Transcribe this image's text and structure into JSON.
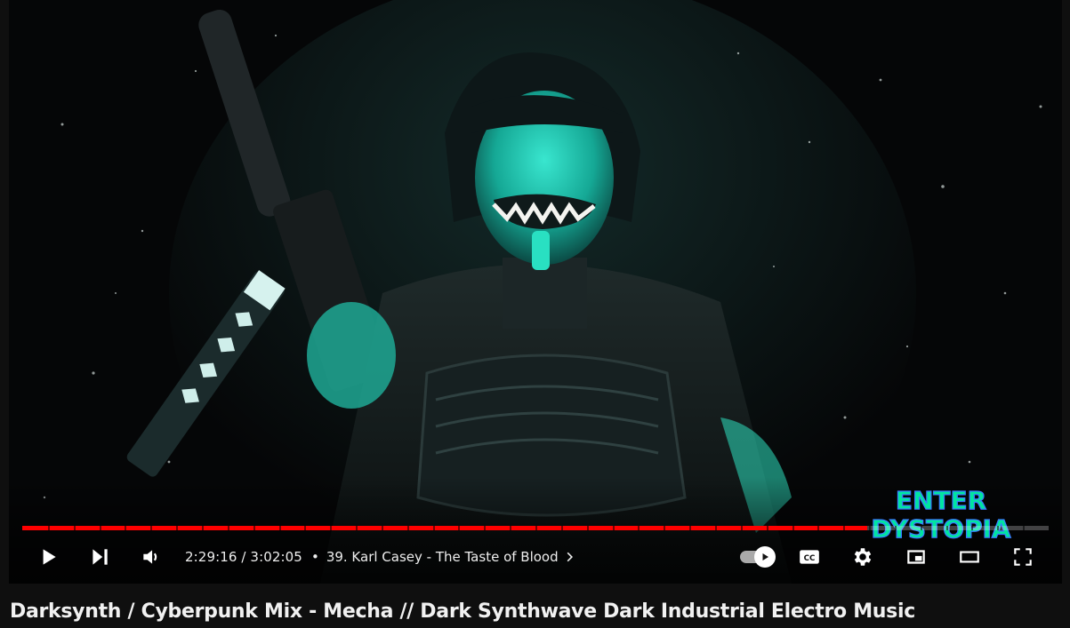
{
  "player": {
    "progress_fraction": 0.8233,
    "time_current": "2:29:16",
    "time_separator": " / ",
    "time_total": "3:02:05",
    "chapter_separator": "•",
    "chapter_title": "39. Karl Casey - The Taste of Blood",
    "accent_color": "#ff0000",
    "logo_text_line1": "ENTER",
    "logo_text_line2": "DYSTOPIA",
    "icons": {
      "play": "play-icon",
      "next": "next-icon",
      "volume": "volume-icon",
      "chapter_chevron": "chevron-right-icon",
      "autoplay": "autoplay-toggle",
      "captions": "cc-icon",
      "settings": "gear-icon",
      "miniplayer": "miniplayer-icon",
      "theater": "theater-icon",
      "fullscreen": "fullscreen-icon"
    }
  },
  "video": {
    "title": "Darksynth / Cyberpunk Mix - Mecha // Dark Synthwave Dark Industrial Electro Music"
  }
}
